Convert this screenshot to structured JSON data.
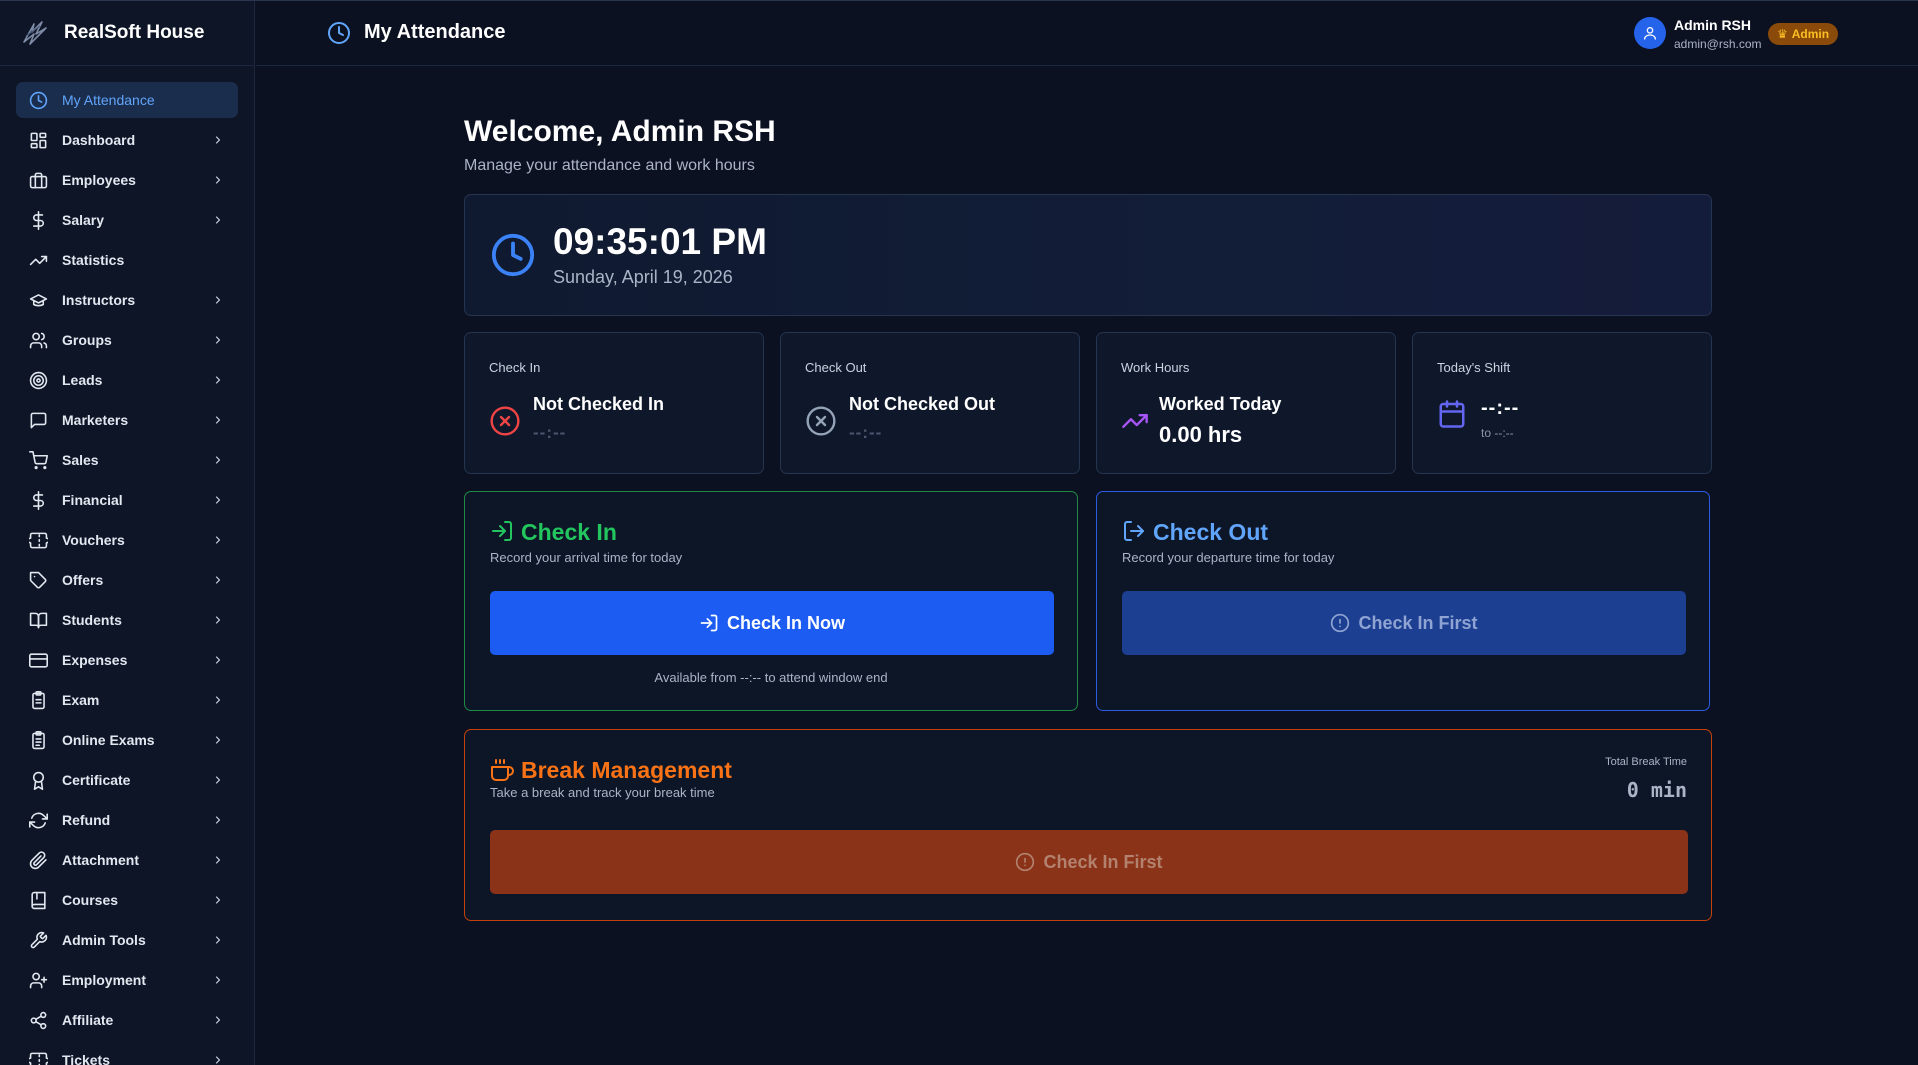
{
  "app": {
    "brand": "RealSoft House"
  },
  "header": {
    "title": "My Attendance",
    "user_name": "Admin RSH",
    "user_email": "admin@rsh.com",
    "role_badge": "Admin",
    "role_icon": "crown-icon"
  },
  "sidebar": {
    "items": [
      {
        "label": "My Attendance",
        "icon": "clock-icon",
        "active": true,
        "chevron": false
      },
      {
        "label": "Dashboard",
        "icon": "dashboard-icon",
        "chevron": true
      },
      {
        "label": "Employees",
        "icon": "briefcase-icon",
        "chevron": true
      },
      {
        "label": "Salary",
        "icon": "dollar-icon",
        "chevron": true
      },
      {
        "label": "Statistics",
        "icon": "trending-up-icon",
        "chevron": false
      },
      {
        "label": "Instructors",
        "icon": "graduation-cap-icon",
        "chevron": true
      },
      {
        "label": "Groups",
        "icon": "users-icon",
        "chevron": true
      },
      {
        "label": "Leads",
        "icon": "target-icon",
        "chevron": true
      },
      {
        "label": "Marketers",
        "icon": "message-square-icon",
        "chevron": true
      },
      {
        "label": "Sales",
        "icon": "cart-icon",
        "chevron": true
      },
      {
        "label": "Financial",
        "icon": "dollar-icon",
        "chevron": true
      },
      {
        "label": "Vouchers",
        "icon": "ticket-icon",
        "chevron": true
      },
      {
        "label": "Offers",
        "icon": "tag-icon",
        "chevron": true
      },
      {
        "label": "Students",
        "icon": "book-open-icon",
        "chevron": true
      },
      {
        "label": "Expenses",
        "icon": "credit-card-icon",
        "chevron": true
      },
      {
        "label": "Exam",
        "icon": "clipboard-icon",
        "chevron": true
      },
      {
        "label": "Online Exams",
        "icon": "clipboard-list-icon",
        "chevron": true
      },
      {
        "label": "Certificate",
        "icon": "award-icon",
        "chevron": true
      },
      {
        "label": "Refund",
        "icon": "refresh-icon",
        "chevron": true
      },
      {
        "label": "Attachment",
        "icon": "paperclip-icon",
        "chevron": true
      },
      {
        "label": "Courses",
        "icon": "book-icon",
        "chevron": true
      },
      {
        "label": "Admin Tools",
        "icon": "wrench-icon",
        "chevron": true
      },
      {
        "label": "Employment",
        "icon": "user-plus-icon",
        "chevron": true
      },
      {
        "label": "Affiliate",
        "icon": "share-icon",
        "chevron": true
      },
      {
        "label": "Tickets",
        "icon": "ticket-icon",
        "chevron": true
      }
    ]
  },
  "welcome": {
    "title": "Welcome, Admin RSH",
    "subtitle": "Manage your attendance and work hours"
  },
  "clock": {
    "time": "09:35:01 PM",
    "date": "Sunday, April 19, 2026"
  },
  "stats": {
    "check_in": {
      "label": "Check In",
      "value": "Not Checked In",
      "sub": "--:--"
    },
    "check_out": {
      "label": "Check Out",
      "value": "Not Checked Out",
      "sub": "--:--"
    },
    "work_hours": {
      "label": "Work Hours",
      "value": "Worked Today",
      "amount": "0.00 hrs"
    },
    "shift": {
      "label": "Today's Shift",
      "value": "--:--",
      "to": "to --:--"
    }
  },
  "check_in_card": {
    "title": "Check In",
    "subtitle": "Record your arrival time for today",
    "button": "Check In Now",
    "note": "Available from --:-- to attend window end"
  },
  "check_out_card": {
    "title": "Check Out",
    "subtitle": "Record your departure time for today",
    "button": "Check In First"
  },
  "break_card": {
    "title": "Break Management",
    "subtitle": "Take a break and track your break time",
    "total_label": "Total Break Time",
    "total_value": "0 min",
    "button": "Check In First"
  },
  "colors": {
    "accent_blue": "#1d5cf2",
    "success_green": "#22c55e",
    "warning_orange": "#f97316",
    "danger_red": "#ef4444",
    "purple": "#a855f7"
  }
}
